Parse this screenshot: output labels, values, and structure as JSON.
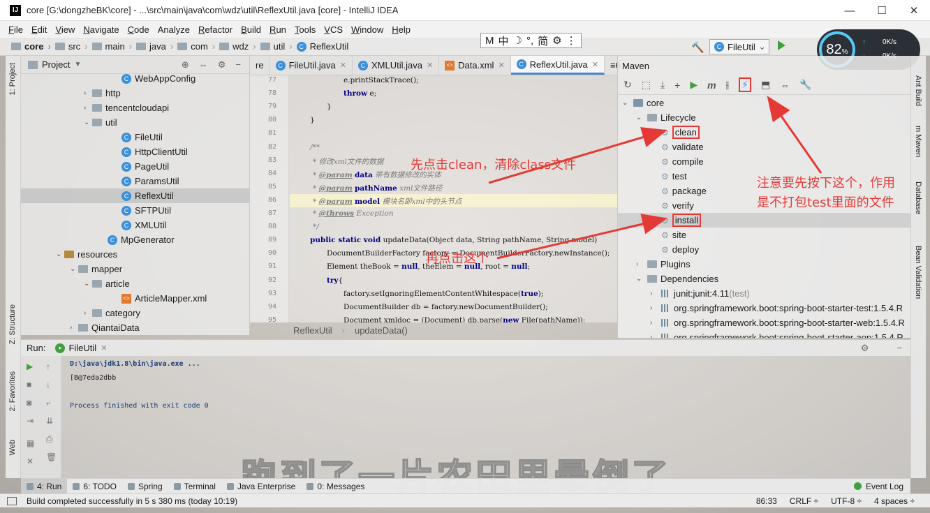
{
  "window": {
    "title": "core [G:\\dongzheBK\\core] - ...\\src\\main\\java\\com\\wdz\\util\\ReflexUtil.java [core] - IntelliJ IDEA",
    "app_icon": "IJ",
    "buttons": [
      "—",
      "☐",
      "✕"
    ]
  },
  "menu": [
    {
      "ul": "F",
      "rest": "ile"
    },
    {
      "ul": "E",
      "rest": "dit"
    },
    {
      "ul": "V",
      "rest": "iew"
    },
    {
      "ul": "N",
      "rest": "avigate"
    },
    {
      "ul": "C",
      "rest": "ode"
    },
    {
      "ul": "",
      "rest": "Analyze"
    },
    {
      "ul": "R",
      "rest": "efactor"
    },
    {
      "ul": "B",
      "rest": "uild"
    },
    {
      "ul": "R",
      "rest": "un"
    },
    {
      "ul": "T",
      "rest": "ools"
    },
    {
      "ul": "V",
      "rest": "CS"
    },
    {
      "ul": "W",
      "rest": "indow"
    },
    {
      "ul": "H",
      "rest": "elp"
    }
  ],
  "ime": [
    "M",
    "中",
    "☽",
    "°,",
    "简",
    "⚙",
    "⋮"
  ],
  "breadcrumbs": [
    "core",
    "src",
    "main",
    "java",
    "com",
    "wdz",
    "util",
    "ReflexUtil"
  ],
  "run_config": "FileUtil",
  "speed_widget": {
    "percent": "82",
    "unit": "%",
    "up": "0K/s",
    "down": "0K/s"
  },
  "left_tool_tabs": [
    "1: Project",
    "Z: Structure",
    "2: Favorites",
    "Web"
  ],
  "project_panel": {
    "title": "Project",
    "tree": [
      {
        "label": "WebAppConfig",
        "kind": "class",
        "indent": 144,
        "arrow": ""
      },
      {
        "label": "http",
        "kind": "folder",
        "indent": 104,
        "arrow": "›"
      },
      {
        "label": "tencentcloudapi",
        "kind": "folder",
        "indent": 104,
        "arrow": "›"
      },
      {
        "label": "util",
        "kind": "folder",
        "indent": 104,
        "arrow": "⌄"
      },
      {
        "label": "FileUtil",
        "kind": "class",
        "indent": 144,
        "arrow": ""
      },
      {
        "label": "HttpClientUtil",
        "kind": "class",
        "indent": 144,
        "arrow": ""
      },
      {
        "label": "PageUtil",
        "kind": "class",
        "indent": 144,
        "arrow": ""
      },
      {
        "label": "ParamsUtil",
        "kind": "class",
        "indent": 144,
        "arrow": ""
      },
      {
        "label": "ReflexUtil",
        "kind": "class",
        "indent": 144,
        "arrow": "",
        "selected": true
      },
      {
        "label": "SFTPUtil",
        "kind": "class",
        "indent": 144,
        "arrow": ""
      },
      {
        "label": "XMLUtil",
        "kind": "class",
        "indent": 144,
        "arrow": ""
      },
      {
        "label": "MpGenerator",
        "kind": "class",
        "indent": 124,
        "arrow": ""
      },
      {
        "label": "resources",
        "kind": "res",
        "indent": 64,
        "arrow": "⌄"
      },
      {
        "label": "mapper",
        "kind": "folder",
        "indent": 84,
        "arrow": "⌄"
      },
      {
        "label": "article",
        "kind": "folder",
        "indent": 104,
        "arrow": "⌄"
      },
      {
        "label": "ArticleMapper.xml",
        "kind": "xml",
        "indent": 144,
        "arrow": ""
      },
      {
        "label": "category",
        "kind": "folder",
        "indent": 104,
        "arrow": "›"
      },
      {
        "label": "QiantaiData",
        "kind": "folder",
        "indent": 84,
        "arrow": "›"
      }
    ]
  },
  "editor_tabs": [
    {
      "label": "re",
      "kind": "partial"
    },
    {
      "label": "FileUtil.java",
      "kind": "class"
    },
    {
      "label": "XMLUtil.java",
      "kind": "class"
    },
    {
      "label": "Data.xml",
      "kind": "xml"
    },
    {
      "label": "ReflexUtil.java",
      "kind": "class",
      "active": true
    },
    {
      "label": "≡6",
      "kind": "more"
    }
  ],
  "editor": {
    "line_numbers": [
      "77",
      "78",
      "79",
      "80",
      "81",
      "82",
      "83",
      "84",
      "85",
      "86",
      "87",
      "88",
      "89",
      "90",
      "91",
      "92",
      "93",
      "94",
      "95"
    ],
    "current_line": "86",
    "code": [
      {
        "indent": 72,
        "parts": [
          [
            "",
            "e.printStackTrace();"
          ]
        ]
      },
      {
        "indent": 72,
        "parts": [
          [
            "kw",
            "throw"
          ],
          [
            "",
            " e;"
          ]
        ]
      },
      {
        "indent": 48,
        "parts": [
          [
            "",
            "}"
          ]
        ]
      },
      {
        "indent": 24,
        "parts": [
          [
            "",
            "}"
          ]
        ]
      },
      {
        "indent": 0,
        "parts": [
          [
            "",
            ""
          ]
        ]
      },
      {
        "indent": 24,
        "parts": [
          [
            "cm",
            "/**"
          ]
        ]
      },
      {
        "indent": 28,
        "parts": [
          [
            "cm",
            "* 修改xml文件的数据"
          ]
        ]
      },
      {
        "indent": 28,
        "parts": [
          [
            "cm",
            "* "
          ],
          [
            "tag",
            "@param"
          ],
          [
            "cm",
            " "
          ],
          [
            "kw",
            "data"
          ],
          [
            "cm",
            " 带有数据修改的实体"
          ]
        ]
      },
      {
        "indent": 28,
        "parts": [
          [
            "cm",
            "* "
          ],
          [
            "tag",
            "@param"
          ],
          [
            "cm",
            " "
          ],
          [
            "kw",
            "pathName"
          ],
          [
            "cm",
            " xml文件路径"
          ]
        ]
      },
      {
        "indent": 28,
        "parts": [
          [
            "cm",
            "* "
          ],
          [
            "tag",
            "@param"
          ],
          [
            "cm",
            " "
          ],
          [
            "kw",
            "model"
          ],
          [
            "cm",
            " 模块名即xml中的头节点"
          ]
        ]
      },
      {
        "indent": 28,
        "parts": [
          [
            "cm",
            "* "
          ],
          [
            "tag",
            "@throws"
          ],
          [
            "cm",
            " Exception"
          ]
        ]
      },
      {
        "indent": 28,
        "parts": [
          [
            "cm",
            "*/"
          ]
        ]
      },
      {
        "indent": 24,
        "parts": [
          [
            "kw",
            "public static void"
          ],
          [
            "",
            " updateData(Object data, String pathName, String model)"
          ]
        ]
      },
      {
        "indent": 48,
        "parts": [
          [
            "",
            "DocumentBuilderFactory factory = DocumentBuilderFactory.newInstance();"
          ]
        ]
      },
      {
        "indent": 48,
        "parts": [
          [
            "",
            "Element theBook = "
          ],
          [
            "kw",
            "null"
          ],
          [
            "",
            ", theElem = "
          ],
          [
            "kw",
            "null"
          ],
          [
            "",
            ", root = "
          ],
          [
            "kw",
            "null"
          ],
          [
            "",
            ";"
          ]
        ]
      },
      {
        "indent": 48,
        "parts": [
          [
            "kw",
            "try"
          ],
          [
            "",
            "{"
          ]
        ]
      },
      {
        "indent": 72,
        "parts": [
          [
            "",
            "factory.setIgnoringElementContentWhitespace("
          ],
          [
            "kw",
            "true"
          ],
          [
            "",
            ");"
          ]
        ]
      },
      {
        "indent": 72,
        "parts": [
          [
            "",
            "DocumentBuilder db = factory.newDocumentBuilder();"
          ]
        ]
      },
      {
        "indent": 72,
        "parts": [
          [
            "",
            "Document xmldoc = (Document) db.parse("
          ],
          [
            "kw",
            "new"
          ],
          [
            "",
            " File(pathName));"
          ]
        ]
      }
    ],
    "breadcrumb": [
      "ReflexUtil",
      "updateData()"
    ]
  },
  "maven_panel": {
    "title": "Maven",
    "toolbar": [
      "↻",
      "⬚",
      "⤓",
      "+",
      "▶",
      "m",
      "⫲",
      "⚡",
      "⬒",
      "⇔",
      "🔧"
    ],
    "tree": [
      {
        "label": "core",
        "kind": "module",
        "indent": 22,
        "arrow": "⌄"
      },
      {
        "label": "Lifecycle",
        "kind": "folder",
        "indent": 42,
        "arrow": "⌄"
      },
      {
        "label": "clean",
        "kind": "goal",
        "indent": 62,
        "boxed": true
      },
      {
        "label": "validate",
        "kind": "goal",
        "indent": 62
      },
      {
        "label": "compile",
        "kind": "goal",
        "indent": 62
      },
      {
        "label": "test",
        "kind": "goal",
        "indent": 62
      },
      {
        "label": "package",
        "kind": "goal",
        "indent": 62
      },
      {
        "label": "verify",
        "kind": "goal",
        "indent": 62
      },
      {
        "label": "install",
        "kind": "goal",
        "indent": 62,
        "boxed": true,
        "selected": true
      },
      {
        "label": "site",
        "kind": "goal",
        "indent": 62
      },
      {
        "label": "deploy",
        "kind": "goal",
        "indent": 62
      },
      {
        "label": "Plugins",
        "kind": "folder",
        "indent": 42,
        "arrow": "›"
      },
      {
        "label": "Dependencies",
        "kind": "folder",
        "indent": 42,
        "arrow": "⌄"
      },
      {
        "label": "junit:junit:4.11",
        "suffix": " (test)",
        "kind": "lib",
        "indent": 62,
        "arrow": "›"
      },
      {
        "label": "org.springframework.boot:spring-boot-starter-test:1.5.4.R",
        "kind": "lib",
        "indent": 62,
        "arrow": "›"
      },
      {
        "label": "org.springframework.boot:spring-boot-starter-web:1.5.4.R",
        "kind": "lib",
        "indent": 62,
        "arrow": "›"
      },
      {
        "label": "org.springframework.boot:spring-boot-starter-aop:1.5.4.R",
        "kind": "lib",
        "indent": 62,
        "arrow": "›"
      }
    ]
  },
  "right_tool_tabs": [
    "Ant Build",
    "m Maven",
    "Database",
    "Bean Validation"
  ],
  "run_panel": {
    "label": "Run:",
    "tab": "FileUtil",
    "console": [
      {
        "text": "D:\\java\\jdk1.8\\bin\\java.exe ...",
        "color": "#1a3a7a",
        "bold": true
      },
      {
        "text": "[B@7eda2dbb",
        "color": "#1a1a1a"
      },
      {
        "text": "",
        "color": "#1a1a1a"
      },
      {
        "text": "Process finished with exit code 0",
        "color": "#1a3a7a"
      }
    ]
  },
  "subtitle": "跑到了一片农田里晕倒了",
  "bottom_tabs": [
    {
      "label": "4: Run",
      "active": true
    },
    {
      "label": "6: TODO"
    },
    {
      "label": "Spring"
    },
    {
      "label": "Terminal"
    },
    {
      "label": "Java Enterprise"
    },
    {
      "label": "0: Messages"
    }
  ],
  "event_log": "Event Log",
  "status": {
    "message": "Build completed successfully in 5 s 380 ms (today 10:19)",
    "position": "86:33",
    "line_sep": "CRLF ÷",
    "encoding": "UTF-8 ÷",
    "indent": "4 spaces ÷"
  },
  "annotations": {
    "clean_note": "先点击clean，清除class文件",
    "install_note": "再点击这个",
    "skip_test_note_1": "注意要先按下这个，作用",
    "skip_test_note_2": "是不打包test里面的文件",
    "color": "#e53935"
  }
}
